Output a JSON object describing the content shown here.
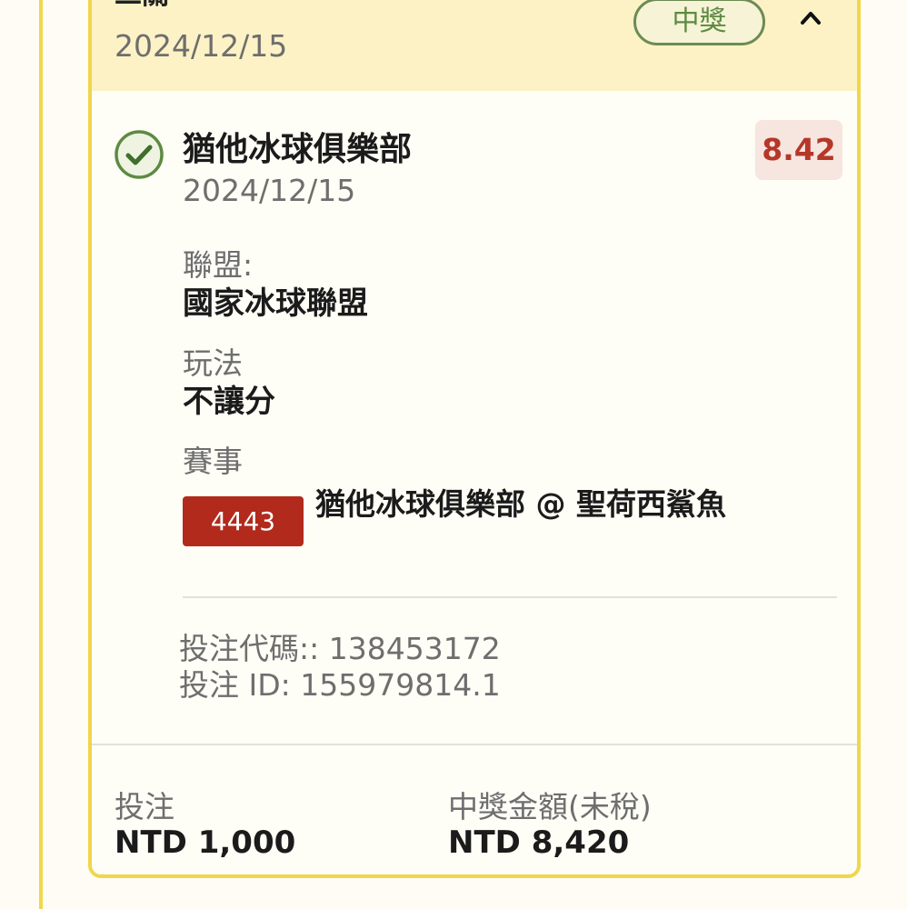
{
  "header": {
    "title": "二關",
    "date": "2024/12/15",
    "status_badge": "中獎"
  },
  "selection": {
    "team": "猶他冰球俱樂部",
    "date": "2024/12/15",
    "odds": "8.42",
    "league_label": "聯盟:",
    "league_value": "國家冰球聯盟",
    "market_label": "玩法",
    "market_value": "不讓分",
    "event_label": "賽事",
    "match_id": "4443",
    "match_name": "猶他冰球俱樂部 @ 聖荷西鯊魚"
  },
  "bet_info": {
    "code": "投注代碼:: 138453172",
    "id": "投注 ID: 155979814.1"
  },
  "footer": {
    "stake_label": "投注",
    "stake_value": "NTD 1,000",
    "payout_label": "中獎金額(未稅)",
    "payout_value": "NTD 8,420"
  },
  "colors": {
    "card_border": "#f0d64a",
    "header_bg": "#fcf2c5",
    "win_green": "#5d8a42",
    "odds_red": "#b5372a",
    "match_id_bg": "#b22a1c"
  },
  "icons": {
    "collapse": "chevron-up-icon",
    "selection_status": "check-circle-icon"
  }
}
